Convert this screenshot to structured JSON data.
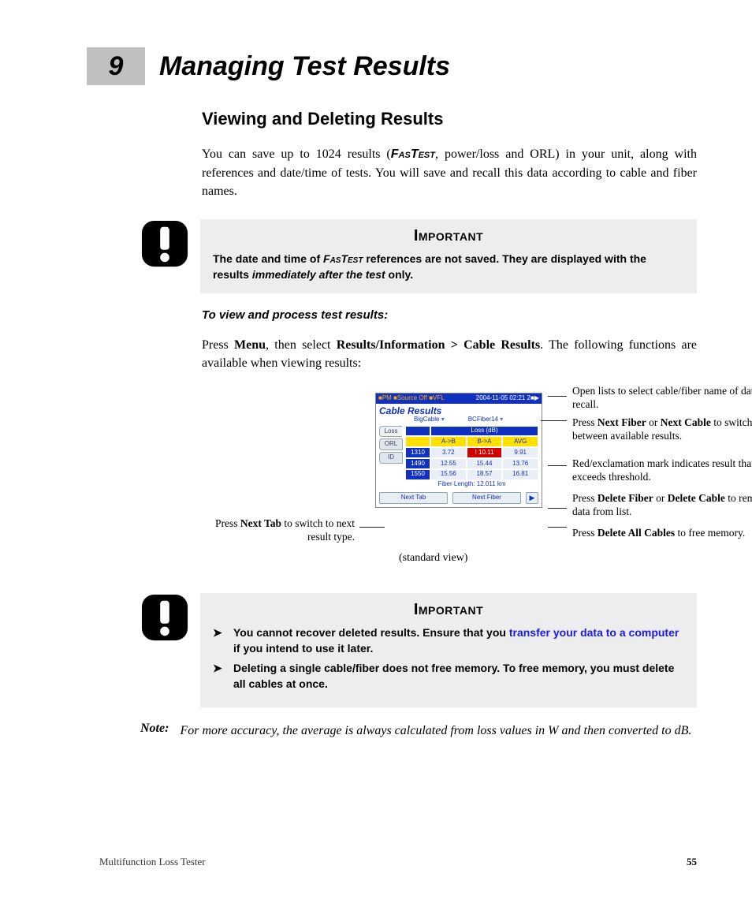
{
  "chapter": {
    "number": "9",
    "title": "Managing Test Results"
  },
  "section_title": "Viewing and Deleting Results",
  "intro": {
    "pre": "You can save up to 1024 results (",
    "fastest": "FasTest",
    "post": ", power/loss and ORL) in your unit, along with references and date/time of tests. You will save and recall this data according to cable and fiber names."
  },
  "callout1": {
    "title": "Important",
    "line1_pre": "The date and time of ",
    "fastest": "FasTest",
    "line1_mid": " references are not saved. They are displayed with the results ",
    "emph": "immediately after the test",
    "line1_post": " only."
  },
  "subhead": "To view and process test results:",
  "step": {
    "pre": "Press ",
    "b1": "Menu",
    "mid1": ", then select ",
    "b2": "Results/Information > Cable Results",
    "post": ". The following functions are available when viewing results:"
  },
  "screen": {
    "status_left": "■PM  ■Source Off ■VFL",
    "status_right": "2004-11-05 02:21 2■▶",
    "title": "Cable Results",
    "dd_cable": "BigCable",
    "dd_fiber": "BCFiber14",
    "tabs": [
      "Loss",
      "ORL",
      "ID"
    ],
    "hdr_span": "Loss (dB)",
    "hdr_cols": [
      "A->B",
      "B->A",
      "AVG"
    ],
    "rows": [
      {
        "wl": "1310",
        "a": "3.72",
        "b": "! 10.11",
        "avg": "9.91",
        "b_red": true
      },
      {
        "wl": "1490",
        "a": "12.55",
        "b": "15.44",
        "avg": "13.76"
      },
      {
        "wl": "1550",
        "a": "15.56",
        "b": "18.57",
        "avg": "16.81"
      }
    ],
    "fiber_length": "Fiber Length: 12.011 km",
    "btn_tab": "Next Tab",
    "btn_fiber": "Next Fiber",
    "btn_right": "▶"
  },
  "annotations": {
    "left_tab": {
      "pre": "Press ",
      "b": "Next Tab",
      "post": " to switch to next result type."
    },
    "std_view": "(standard view)",
    "r1": "Open lists to select cable/fiber name of data to recall.",
    "r2": {
      "pre": "Press ",
      "b1": "Next Fiber",
      "mid": " or ",
      "b2": "Next Cable",
      "post": " to switch between available results."
    },
    "r3": "Red/exclamation mark indicates result that exceeds threshold.",
    "r4": {
      "pre": "Press ",
      "b1": "Delete Fiber",
      "mid": " or ",
      "b2": "Delete Cable",
      "post": " to remove data from list."
    },
    "r5": {
      "pre": "Press ",
      "b": "Delete All Cables",
      "post": " to free memory."
    }
  },
  "callout2": {
    "title": "Important",
    "li1_pre": "You cannot recover deleted results. Ensure that you ",
    "li1_link": "transfer your data to a computer",
    "li1_post": " if you intend to use it later.",
    "li2": "Deleting a single cable/fiber does not free memory. To free memory, you must delete all cables at once."
  },
  "note": {
    "label": "Note:",
    "text": "For more accuracy, the average is always calculated from loss values in W and then converted to dB."
  },
  "footer": {
    "product": "Multifunction Loss Tester",
    "page": "55"
  }
}
